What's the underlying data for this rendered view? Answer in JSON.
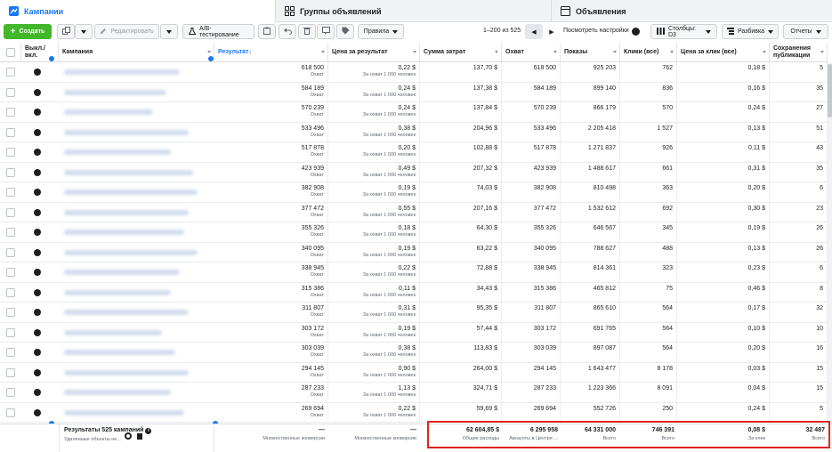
{
  "tabs": {
    "campaigns": "Кампании",
    "adsets": "Группы объявлений",
    "ads": "Объявления"
  },
  "toolbar": {
    "create": "Создать",
    "edit": "Редактировать",
    "ab_test": "A/B-тестирование",
    "rules": "Правила",
    "page_info": "1–200 из 525",
    "view_settings": "Посмотреть настройки",
    "columns": "Столбцы: D3",
    "breakdown": "Разбивка",
    "reports": "Отчеты"
  },
  "headers": {
    "toggle": "Выкл./вкл.",
    "campaign": "Кампания",
    "result": "Результат↓",
    "cpr": "Цена за результат",
    "spend": "Сумма затрат",
    "reach": "Охват",
    "impressions": "Показы",
    "clicks": "Клики (все)",
    "cpc": "Цена за клик (все)",
    "saves": "Сохранения публикации"
  },
  "labels": {
    "reach": "Охват",
    "per_1000": "За охват 1 000 человек"
  },
  "rows": [
    {
      "result": "618 500",
      "cpr": "0,22 $",
      "spend": "137,70 $",
      "reach": "618 500",
      "impressions": "925 203",
      "clicks": "762",
      "cpc": "0,18 $",
      "saves": "5"
    },
    {
      "result": "584 189",
      "cpr": "0,24 $",
      "spend": "137,38 $",
      "reach": "584 189",
      "impressions": "899 140",
      "clicks": "836",
      "cpc": "0,16 $",
      "saves": "35"
    },
    {
      "result": "570 239",
      "cpr": "0,24 $",
      "spend": "137,84 $",
      "reach": "570 239",
      "impressions": "866 179",
      "clicks": "570",
      "cpc": "0,24 $",
      "saves": "27"
    },
    {
      "result": "533 496",
      "cpr": "0,38 $",
      "spend": "204,96 $",
      "reach": "533 496",
      "impressions": "2 205 418",
      "clicks": "1 527",
      "cpc": "0,13 $",
      "saves": "51"
    },
    {
      "result": "517 878",
      "cpr": "0,20 $",
      "spend": "102,88 $",
      "reach": "517 878",
      "impressions": "1 271 837",
      "clicks": "926",
      "cpc": "0,11 $",
      "saves": "43"
    },
    {
      "result": "423 939",
      "cpr": "0,49 $",
      "spend": "207,32 $",
      "reach": "423 939",
      "impressions": "1 488 617",
      "clicks": "661",
      "cpc": "0,31 $",
      "saves": "35"
    },
    {
      "result": "382 908",
      "cpr": "0,19 $",
      "spend": "74,03 $",
      "reach": "382 908",
      "impressions": "810 498",
      "clicks": "363",
      "cpc": "0,20 $",
      "saves": "6"
    },
    {
      "result": "377 472",
      "cpr": "0,55 $",
      "spend": "207,16 $",
      "reach": "377 472",
      "impressions": "1 532 612",
      "clicks": "692",
      "cpc": "0,30 $",
      "saves": "23"
    },
    {
      "result": "355 326",
      "cpr": "0,18 $",
      "spend": "64,30 $",
      "reach": "355 326",
      "impressions": "646 567",
      "clicks": "345",
      "cpc": "0,19 $",
      "saves": "26"
    },
    {
      "result": "340 095",
      "cpr": "0,19 $",
      "spend": "63,22 $",
      "reach": "340 095",
      "impressions": "788 627",
      "clicks": "488",
      "cpc": "0,13 $",
      "saves": "26"
    },
    {
      "result": "338 945",
      "cpr": "0,22 $",
      "spend": "72,88 $",
      "reach": "338 945",
      "impressions": "814 361",
      "clicks": "323",
      "cpc": "0,23 $",
      "saves": "6"
    },
    {
      "result": "315 386",
      "cpr": "0,11 $",
      "spend": "34,43 $",
      "reach": "315 386",
      "impressions": "465 812",
      "clicks": "75",
      "cpc": "0,46 $",
      "saves": "8"
    },
    {
      "result": "311 807",
      "cpr": "0,31 $",
      "spend": "95,35 $",
      "reach": "311 807",
      "impressions": "865 610",
      "clicks": "564",
      "cpc": "0,17 $",
      "saves": "32"
    },
    {
      "result": "303 172",
      "cpr": "0,19 $",
      "spend": "57,44 $",
      "reach": "303 172",
      "impressions": "691 765",
      "clicks": "564",
      "cpc": "0,10 $",
      "saves": "10"
    },
    {
      "result": "303 039",
      "cpr": "0,38 $",
      "spend": "113,83 $",
      "reach": "303 039",
      "impressions": "897 087",
      "clicks": "564",
      "cpc": "0,20 $",
      "saves": "16"
    },
    {
      "result": "294 145",
      "cpr": "0,90 $",
      "spend": "264,00 $",
      "reach": "294 145",
      "impressions": "1 643 477",
      "clicks": "8 178",
      "cpc": "0,03 $",
      "saves": "15"
    },
    {
      "result": "287 233",
      "cpr": "1,13 $",
      "spend": "324,71 $",
      "reach": "287 233",
      "impressions": "1 223 366",
      "clicks": "8 091",
      "cpc": "0,04 $",
      "saves": "15"
    },
    {
      "result": "269 694",
      "cpr": "0,22 $",
      "spend": "59,69 $",
      "reach": "269 694",
      "impressions": "552 726",
      "clicks": "250",
      "cpc": "0,24 $",
      "saves": "5"
    }
  ],
  "footer": {
    "title": "Результаты 525 кампаний",
    "subtitle": "Удаленные объекты не...",
    "result": "—",
    "result_sub": "Множественные конверсии",
    "cpr": "—",
    "cpr_sub": "Множественные конверсии",
    "spend": "62 604,85 $",
    "spend_sub": "Общие расходы",
    "reach": "6 295 958",
    "reach_sub": "Аккаунты в Центре ...",
    "impressions": "64 331 000",
    "impressions_sub": "Всего",
    "clicks": "746 391",
    "clicks_sub": "Всего",
    "cpc": "0,08 $",
    "cpc_sub": "За клик",
    "saves": "32 487",
    "saves_sub": "Всего"
  }
}
